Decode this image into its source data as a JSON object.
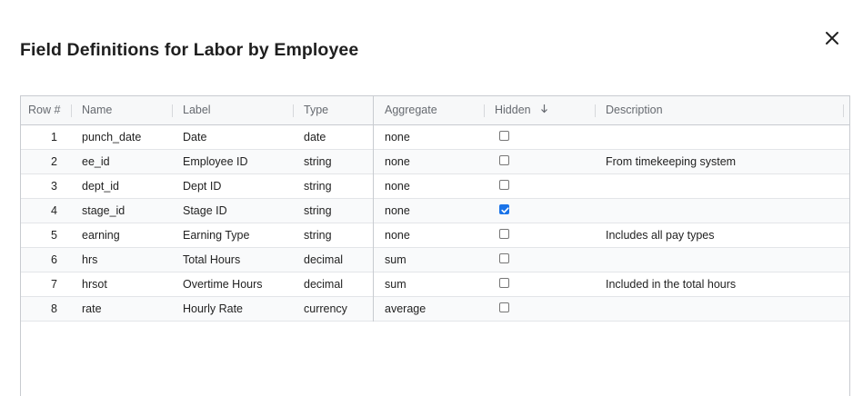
{
  "dialog": {
    "title": "Field Definitions for Labor by Employee",
    "close_icon": "close-icon"
  },
  "grid": {
    "columns": [
      {
        "key": "row",
        "label": "Row #"
      },
      {
        "key": "name",
        "label": "Name"
      },
      {
        "key": "label",
        "label": "Label"
      },
      {
        "key": "type",
        "label": "Type"
      },
      {
        "key": "aggregate",
        "label": "Aggregate"
      },
      {
        "key": "hidden",
        "label": "Hidden",
        "sort_icon": "arrow-down-icon",
        "sort": "descending"
      },
      {
        "key": "description",
        "label": "Description"
      }
    ],
    "rows": [
      {
        "row": "1",
        "name": "punch_date",
        "label": "Date",
        "type": "date",
        "aggregate": "none",
        "hidden": false,
        "description": ""
      },
      {
        "row": "2",
        "name": "ee_id",
        "label": "Employee ID",
        "type": "string",
        "aggregate": "none",
        "hidden": false,
        "description": "From timekeeping system"
      },
      {
        "row": "3",
        "name": "dept_id",
        "label": "Dept ID",
        "type": "string",
        "aggregate": "none",
        "hidden": false,
        "description": ""
      },
      {
        "row": "4",
        "name": "stage_id",
        "label": "Stage ID",
        "type": "string",
        "aggregate": "none",
        "hidden": true,
        "description": ""
      },
      {
        "row": "5",
        "name": "earning",
        "label": "Earning Type",
        "type": "string",
        "aggregate": "none",
        "hidden": false,
        "description": "Includes all pay types"
      },
      {
        "row": "6",
        "name": "hrs",
        "label": "Total Hours",
        "type": "decimal",
        "aggregate": "sum",
        "hidden": false,
        "description": ""
      },
      {
        "row": "7",
        "name": "hrsot",
        "label": "Overtime Hours",
        "type": "decimal",
        "aggregate": "sum",
        "hidden": false,
        "description": "Included in the total hours"
      },
      {
        "row": "8",
        "name": "rate",
        "label": "Hourly Rate",
        "type": "currency",
        "aggregate": "average",
        "hidden": false,
        "description": ""
      }
    ]
  },
  "colors": {
    "checkbox_checked": "#1a73e8",
    "header_bg": "#f7f8f9",
    "border": "#c8cbd0"
  }
}
